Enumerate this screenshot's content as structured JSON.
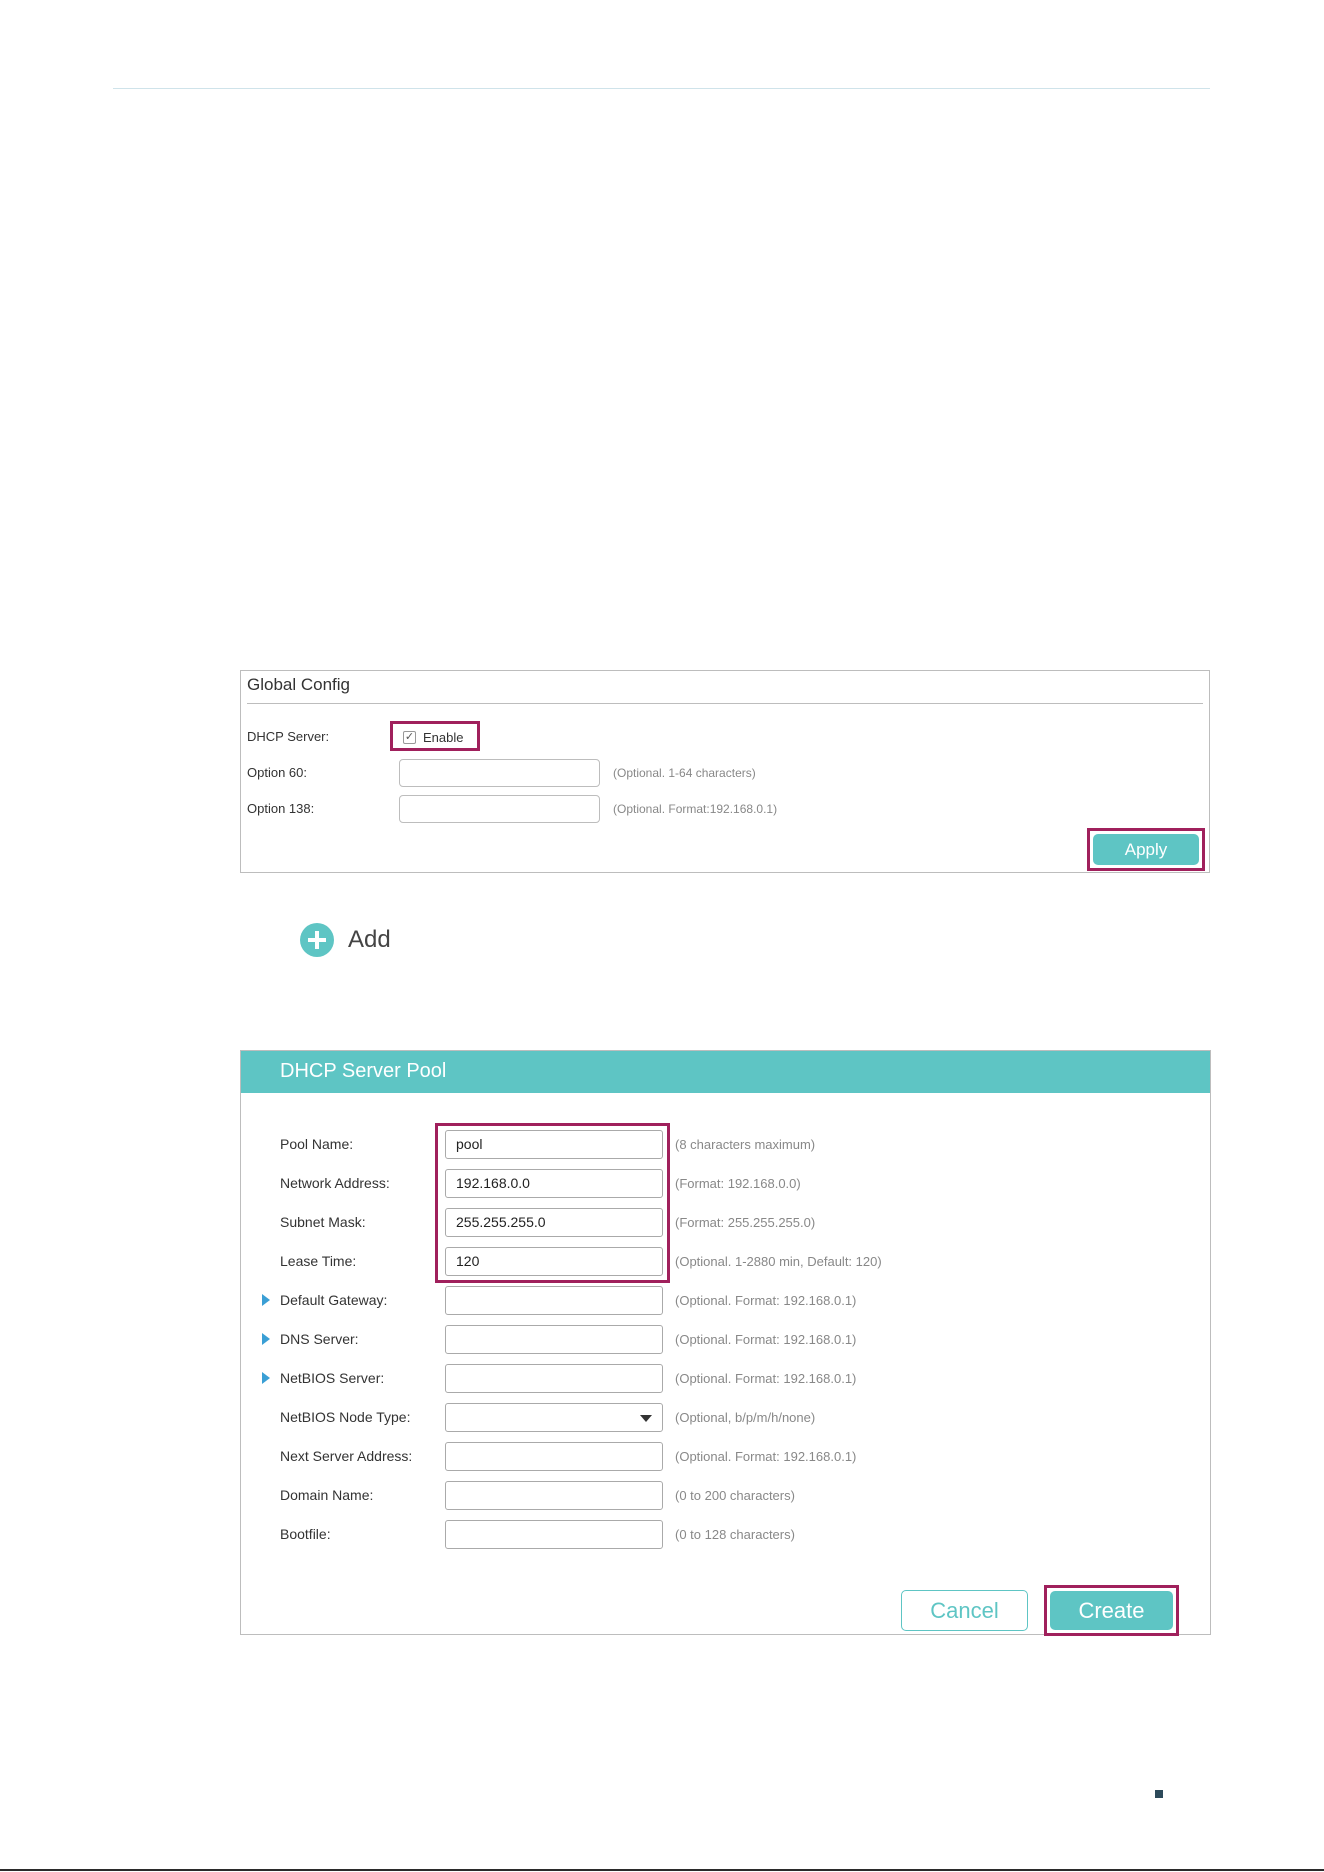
{
  "global_config": {
    "title": "Global Config",
    "dhcp_server_label": "DHCP Server:",
    "enable_checked": true,
    "enable_label": "Enable",
    "option60_label": "Option 60:",
    "option60_value": "",
    "option60_hint": "(Optional. 1-64 characters)",
    "option138_label": "Option 138:",
    "option138_value": "",
    "option138_hint": "(Optional. Format:192.168.0.1)",
    "apply_label": "Apply",
    "check_glyph": "✓"
  },
  "add": {
    "icon": "plus-circle-icon",
    "label": "Add"
  },
  "pool": {
    "title": "DHCP Server Pool",
    "rows": [
      {
        "label": "Pool Name:",
        "value": "pool",
        "hint": "(8 characters maximum)",
        "expandable": false,
        "type": "input"
      },
      {
        "label": "Network Address:",
        "value": "192.168.0.0",
        "hint": "(Format: 192.168.0.0)",
        "expandable": false,
        "type": "input"
      },
      {
        "label": "Subnet Mask:",
        "value": "255.255.255.0",
        "hint": "(Format: 255.255.255.0)",
        "expandable": false,
        "type": "input"
      },
      {
        "label": "Lease Time:",
        "value": "120",
        "hint": "(Optional. 1-2880 min, Default: 120)",
        "expandable": false,
        "type": "input"
      },
      {
        "label": "Default Gateway:",
        "value": "",
        "hint": "(Optional. Format: 192.168.0.1)",
        "expandable": true,
        "type": "input"
      },
      {
        "label": "DNS Server:",
        "value": "",
        "hint": "(Optional. Format: 192.168.0.1)",
        "expandable": true,
        "type": "input"
      },
      {
        "label": "NetBIOS Server:",
        "value": "",
        "hint": "(Optional. Format: 192.168.0.1)",
        "expandable": true,
        "type": "input"
      },
      {
        "label": "NetBIOS Node Type:",
        "value": "",
        "hint": "(Optional, b/p/m/h/none)",
        "expandable": false,
        "type": "select"
      },
      {
        "label": "Next Server Address:",
        "value": "",
        "hint": "(Optional. Format: 192.168.0.1)",
        "expandable": false,
        "type": "input"
      },
      {
        "label": "Domain Name:",
        "value": "",
        "hint": "(0 to 200 characters)",
        "expandable": false,
        "type": "input"
      },
      {
        "label": "Bootfile:",
        "value": "",
        "hint": "(0 to 128 characters)",
        "expandable": false,
        "type": "input"
      }
    ],
    "cancel_label": "Cancel",
    "create_label": "Create"
  },
  "colors": {
    "accent": "#5ec5c4",
    "highlight": "#a0205c",
    "expand_arrow": "#3a9fd5"
  }
}
